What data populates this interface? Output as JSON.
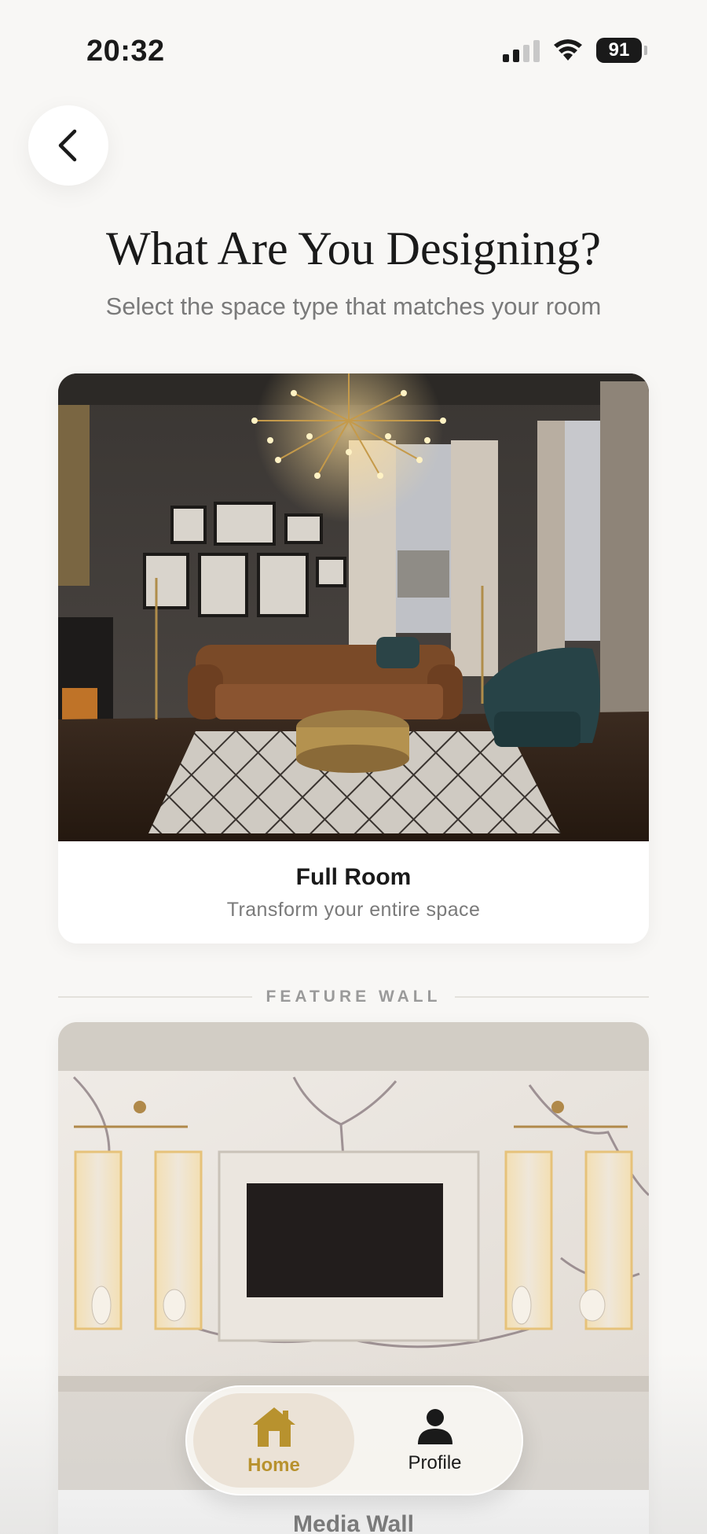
{
  "status_bar": {
    "time": "20:32",
    "battery": "91"
  },
  "page": {
    "title": "What Are You Designing?",
    "subtitle": "Select the space type that matches your room"
  },
  "cards": [
    {
      "title": "Full Room",
      "subtitle": "Transform your entire space"
    },
    {
      "title": "Media Wall"
    }
  ],
  "section": {
    "feature_wall_label": "FEATURE WALL"
  },
  "nav": {
    "items": [
      {
        "label": "Home",
        "active": true
      },
      {
        "label": "Profile",
        "active": false
      }
    ]
  },
  "colors": {
    "accent": "#b8922e",
    "background": "#f8f7f5"
  }
}
